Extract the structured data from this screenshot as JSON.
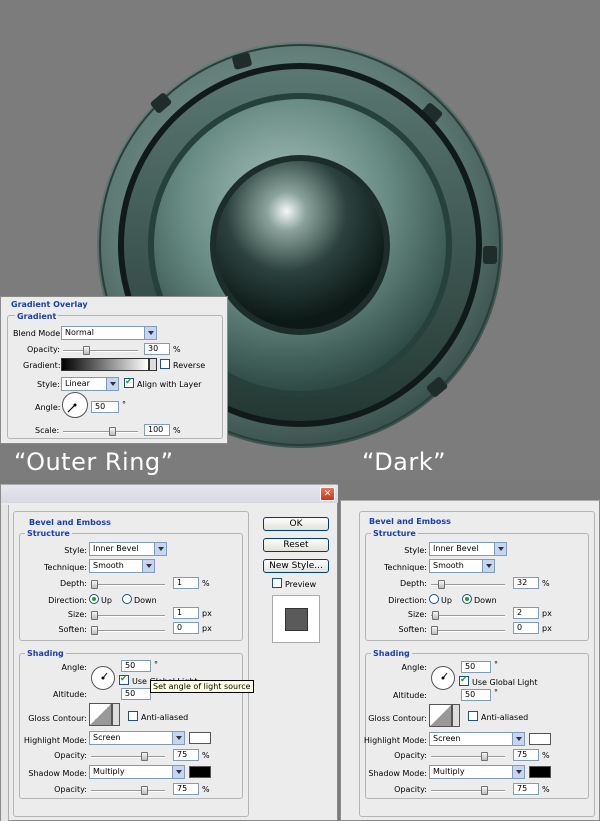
{
  "captions": {
    "outer_ring": "“Outer Ring”",
    "dark": "“Dark”"
  },
  "gradient_overlay": {
    "title": "Gradient Overlay",
    "section": "Gradient",
    "blend_mode_label": "Blend Mode:",
    "blend_mode": "Normal",
    "opacity_label": "Opacity:",
    "opacity": "30",
    "opacity_unit": "%",
    "opacity_level": 0.3,
    "gradient_label": "Gradient:",
    "reverse_label": "Reverse",
    "style_label": "Style:",
    "style": "Linear",
    "align_label": "Align with Layer",
    "angle_label": "Angle:",
    "angle": "50",
    "angle_unit": "°",
    "scale_label": "Scale:",
    "scale": "100",
    "scale_unit": "%",
    "scale_level": 0.67
  },
  "dialog_left": {
    "close_glyph": "✕",
    "buttons": {
      "ok": "OK",
      "reset": "Reset",
      "new_style": "New Style...",
      "preview": "Preview"
    },
    "bevel": {
      "title": "Bevel and Emboss",
      "structure": "Structure",
      "style_label": "Style:",
      "style": "Inner Bevel",
      "technique_label": "Technique:",
      "technique": "Smooth",
      "depth_label": "Depth:",
      "depth": "1",
      "depth_unit": "%",
      "depth_level": 0.0,
      "direction_label": "Direction:",
      "up": "Up",
      "down": "Down",
      "direction": "up",
      "size_label": "Size:",
      "size": "1",
      "size_unit": "px",
      "size_level": 0.0,
      "soften_label": "Soften:",
      "soften": "0",
      "soften_unit": "px",
      "soften_level": 0.0
    },
    "shading": {
      "title": "Shading",
      "angle_label": "Angle:",
      "angle": "50",
      "deg": "°",
      "global_light_label": "Use Global Light",
      "altitude_label": "Altitude:",
      "altitude": "50",
      "alt_deg": "°",
      "tooltip": "Set angle of light source",
      "gloss_label": "Gloss Contour:",
      "anti_aliased": "Anti-aliased",
      "highlight_label": "Highlight Mode:",
      "highlight_mode": "Screen",
      "highlight_color": "#ffffff",
      "h_opacity_label": "Opacity:",
      "h_opacity": "75",
      "h_unit": "%",
      "h_level": 0.75,
      "shadow_label": "Shadow Mode:",
      "shadow_mode": "Multiply",
      "shadow_color": "#000000",
      "s_opacity_label": "Opacity:",
      "s_opacity": "75",
      "s_unit": "%",
      "s_level": 0.75
    }
  },
  "dialog_right": {
    "bevel": {
      "title": "Bevel and Emboss",
      "structure": "Structure",
      "style_label": "Style:",
      "style": "Inner Bevel",
      "technique_label": "Technique:",
      "technique": "Smooth",
      "depth_label": "Depth:",
      "depth": "32",
      "depth_unit": "%",
      "depth_level": 0.1,
      "direction_label": "Direction:",
      "up": "Up",
      "down": "Down",
      "direction": "down",
      "size_label": "Size:",
      "size": "2",
      "size_unit": "px",
      "size_level": 0.02,
      "soften_label": "Soften:",
      "soften": "0",
      "soften_unit": "px",
      "soften_level": 0.0
    },
    "shading": {
      "title": "Shading",
      "angle_label": "Angle:",
      "angle": "50",
      "deg": "°",
      "global_light_label": "Use Global Light",
      "altitude_label": "Altitude:",
      "altitude": "50",
      "alt_deg": "°",
      "gloss_label": "Gloss Contour:",
      "anti_aliased": "Anti-aliased",
      "highlight_label": "Highlight Mode:",
      "highlight_mode": "Screen",
      "highlight_color": "#ffffff",
      "h_opacity_label": "Opacity:",
      "h_opacity": "75",
      "h_unit": "%",
      "h_level": 0.75,
      "shadow_label": "Shadow Mode:",
      "shadow_mode": "Multiply",
      "shadow_color": "#000000",
      "s_opacity_label": "Opacity:",
      "s_opacity": "75",
      "s_unit": "%",
      "s_level": 0.75
    }
  },
  "colors": {
    "speaker_teal": "#3d5e58",
    "dialog_bg": "#ececec",
    "title_blue": "#1a3fae"
  }
}
